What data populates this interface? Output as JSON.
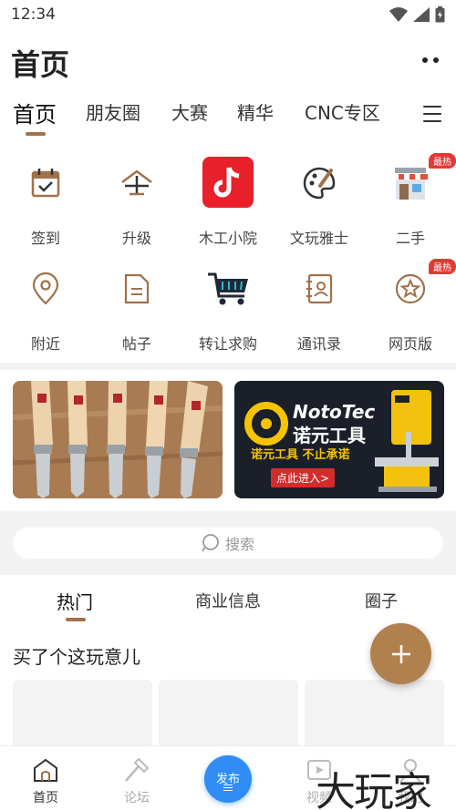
{
  "status_bar": {
    "time": "12:34"
  },
  "app_bar": {
    "title": "首页"
  },
  "top_tabs": [
    {
      "label": "首页",
      "active": true
    },
    {
      "label": "朋友圈",
      "active": false
    },
    {
      "label": "大赛",
      "active": false
    },
    {
      "label": "精华",
      "active": false
    },
    {
      "label": "CNC专区",
      "active": false
    }
  ],
  "grid_row1": [
    {
      "label": "签到",
      "icon": "calendar-check-icon"
    },
    {
      "label": "升级",
      "icon": "upgrade-arrow-icon"
    },
    {
      "label": "木工小院",
      "icon": "tiktok-icon"
    },
    {
      "label": "文玩雅士",
      "icon": "palette-icon"
    },
    {
      "label": "二手",
      "icon": "shop-icon",
      "badge": "最热"
    }
  ],
  "grid_row2": [
    {
      "label": "附近",
      "icon": "location-pin-icon"
    },
    {
      "label": "帖子",
      "icon": "document-icon"
    },
    {
      "label": "转让求购",
      "icon": "shopping-cart-icon"
    },
    {
      "label": "通讯录",
      "icon": "contacts-icon"
    },
    {
      "label": "网页版",
      "icon": "star-circle-icon",
      "badge": "最热"
    }
  ],
  "banners": {
    "right": {
      "brand": "NotoTec",
      "brand_cn": "诺元工具",
      "slogan": "诺元工具 不止承诺",
      "cta": "点此进入>"
    }
  },
  "search": {
    "placeholder": "搜索"
  },
  "sub_tabs": [
    {
      "label": "热门",
      "active": true
    },
    {
      "label": "商业信息",
      "active": false
    },
    {
      "label": "圈子",
      "active": false
    }
  ],
  "section": {
    "title": "买了个这玩意儿"
  },
  "bottom_nav": [
    {
      "label": "首页",
      "active": true,
      "icon": "home-icon"
    },
    {
      "label": "论坛",
      "active": false,
      "icon": "hammer-icon"
    },
    {
      "label": "发布",
      "active": false,
      "icon": "publish-icon"
    },
    {
      "label": "视频",
      "active": false,
      "icon": "video-icon"
    },
    {
      "label": "我的",
      "active": false,
      "icon": "profile-icon"
    }
  ],
  "watermark": "大玩家",
  "colors": {
    "accent": "#a0714a",
    "fab": "#b0814f",
    "publish": "#2f8df5",
    "hot": "#e53935"
  }
}
